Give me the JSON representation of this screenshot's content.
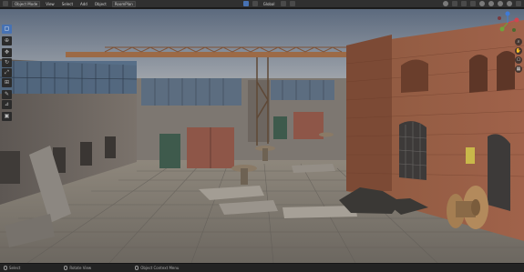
{
  "header": {
    "editor_icon": "3d-viewport-icon",
    "mode": "Object Mode",
    "menus": [
      "View",
      "Select",
      "Add",
      "Object"
    ],
    "shading_label": "RoomPlan",
    "orientation": "Global",
    "options_label": ""
  },
  "toolbar": {
    "tools": [
      {
        "name": "select-box-icon",
        "glyph": "▢",
        "active": true
      },
      {
        "name": "cursor-icon",
        "glyph": "⊕",
        "active": false
      },
      {
        "name": "move-icon",
        "glyph": "✥",
        "active": false
      },
      {
        "name": "rotate-icon",
        "glyph": "↻",
        "active": false
      },
      {
        "name": "scale-icon",
        "glyph": "⤢",
        "active": false
      },
      {
        "name": "transform-icon",
        "glyph": "⊞",
        "active": false
      },
      {
        "name": "annotate-icon",
        "glyph": "✎",
        "active": false
      },
      {
        "name": "measure-icon",
        "glyph": "📏",
        "active": false
      },
      {
        "name": "add-cube-icon",
        "glyph": "▣",
        "active": false
      }
    ]
  },
  "statusbar": {
    "left": "Select",
    "middle": "Rotate View",
    "right": "Object Context Menu"
  },
  "colors": {
    "active_tool": "#4772b3",
    "header_bg": "#303030",
    "status_bg": "#232323"
  }
}
